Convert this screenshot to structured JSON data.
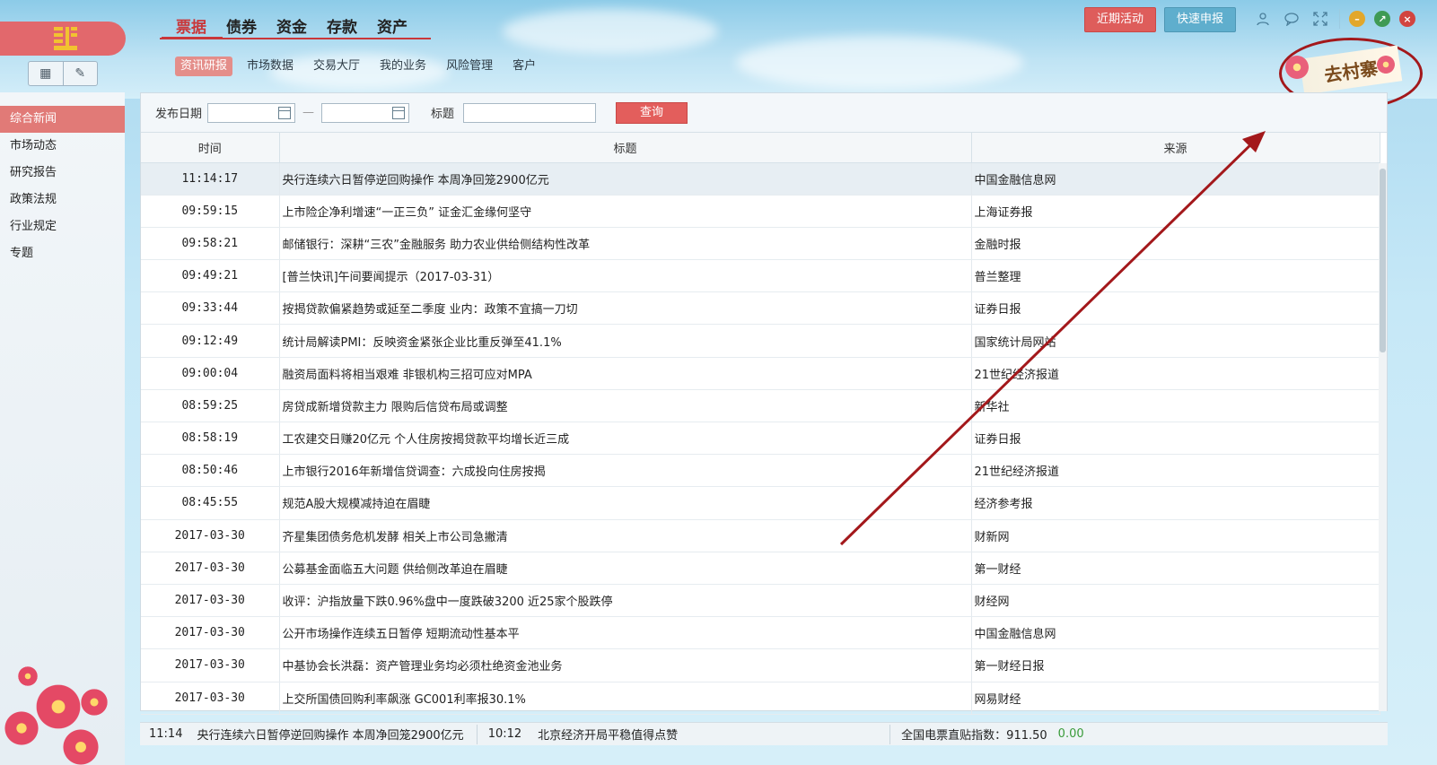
{
  "main_nav": [
    "票据",
    "债券",
    "资金",
    "存款",
    "资产"
  ],
  "main_nav_active": 0,
  "sub_nav": [
    "资讯研报",
    "市场数据",
    "交易大厅",
    "我的业务",
    "风险管理",
    "客户"
  ],
  "sub_nav_active": 0,
  "top_buttons": {
    "activity": "近期活动",
    "report": "快速申报"
  },
  "stamp_text": "去村寨",
  "sidebar": [
    "综合新闻",
    "市场动态",
    "研究报告",
    "政策法规",
    "行业规定",
    "专题"
  ],
  "filters": {
    "date_label": "发布日期",
    "dash": "—",
    "title_label": "标题",
    "query": "查询"
  },
  "columns": [
    "时间",
    "标题",
    "来源"
  ],
  "rows": [
    [
      "11:14:17",
      "央行连续六日暂停逆回购操作 本周净回笼2900亿元",
      "中国金融信息网"
    ],
    [
      "09:59:15",
      "上市险企净利增速“一正三负” 证金汇金缘何坚守",
      "上海证券报"
    ],
    [
      "09:58:21",
      "邮储银行：深耕“三农”金融服务 助力农业供给侧结构性改革",
      "金融时报"
    ],
    [
      "09:49:21",
      "[普兰快讯]午间要闻提示（2017-03-31）",
      "普兰整理"
    ],
    [
      "09:33:44",
      "按揭贷款偏紧趋势或延至二季度 业内：政策不宜搞一刀切",
      "证券日报"
    ],
    [
      "09:12:49",
      "统计局解读PMI：反映资金紧张企业比重反弹至41.1%",
      "国家统计局网站"
    ],
    [
      "09:00:04",
      "融资局面料将相当艰难 非银机构三招可应对MPA",
      "21世纪经济报道"
    ],
    [
      "08:59:25",
      "房贷成新增贷款主力 限购后信贷布局或调整",
      "新华社"
    ],
    [
      "08:58:19",
      "工农建交日赚20亿元 个人住房按揭贷款平均增长近三成",
      "证券日报"
    ],
    [
      "08:50:46",
      "上市银行2016年新增信贷调查：六成投向住房按揭",
      "21世纪经济报道"
    ],
    [
      "08:45:55",
      "规范A股大规模减持迫在眉睫",
      "经济参考报"
    ],
    [
      "2017-03-30",
      "齐星集团债务危机发酵 相关上市公司急撇清",
      "财新网"
    ],
    [
      "2017-03-30",
      "公募基金面临五大问题 供给侧改革迫在眉睫",
      "第一财经"
    ],
    [
      "2017-03-30",
      "收评：沪指放量下跌0.96%盘中一度跌破3200 近25家个股跌停",
      "财经网"
    ],
    [
      "2017-03-30",
      "公开市场操作连续五日暂停 短期流动性基本平",
      "中国金融信息网"
    ],
    [
      "2017-03-30",
      "中基协会长洪磊：资产管理业务均必须杜绝资金池业务",
      "第一财经日报"
    ],
    [
      "2017-03-30",
      "上交所国债回购利率飙涨 GC001利率报30.1%",
      "网易财经"
    ]
  ],
  "selected_row": 0,
  "ticker": {
    "time1": "11:14",
    "news1": "央行连续六日暂停逆回购操作 本周净回笼2900亿元",
    "time2": "10:12",
    "news2": "北京经济开局平稳值得点赞",
    "index_label": "全国电票直贴指数：911.50",
    "index_change": "0.00"
  },
  "colors": {
    "accent": "#c9373a",
    "active_bg": "#e17a77",
    "query_btn": "#e35e5c",
    "report_btn": "#5faecd",
    "annotation": "#a3181b"
  },
  "icons": [
    "user-icon",
    "chat-icon",
    "fullscreen-icon",
    "minimize-icon",
    "restore-icon",
    "close-icon",
    "calendar-icon",
    "grid-icon",
    "pencil-icon"
  ]
}
